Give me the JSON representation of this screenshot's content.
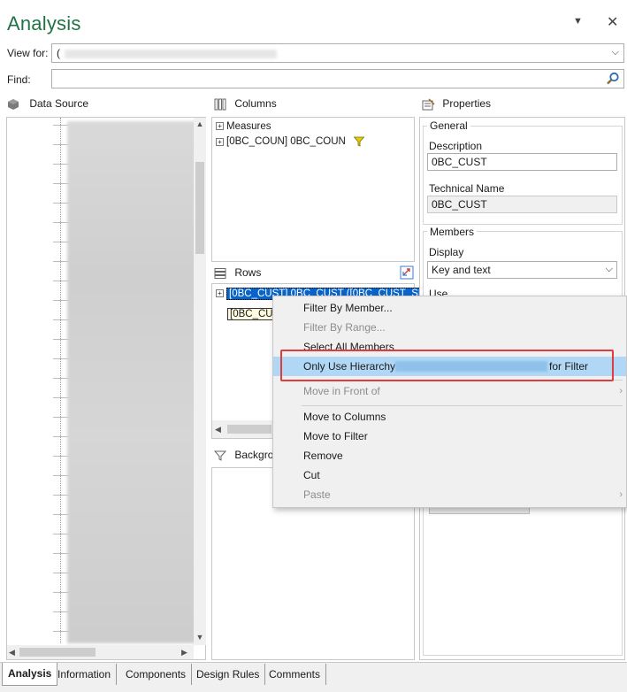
{
  "header": {
    "title": "Analysis",
    "dropdown_icon": "chevron-down-icon",
    "close_icon": "close-icon"
  },
  "view_for": {
    "label": "View for:",
    "value": "("
  },
  "find": {
    "label": "Find:",
    "value": ""
  },
  "data_source": {
    "title": "Data Source"
  },
  "columns": {
    "title": "Columns",
    "items": [
      {
        "label": "Measures"
      },
      {
        "label": "[0BC_COUN] 0BC_COUN"
      }
    ]
  },
  "rows": {
    "title": "Rows",
    "item1": "[0BC_CUST] 0BC_CUST ([0BC_CUST_SRAT...",
    "item2": "[0BC_CUS"
  },
  "background": {
    "title": "Backgro"
  },
  "properties": {
    "title": "Properties",
    "general": {
      "title": "General",
      "description_label": "Description",
      "description_value": "0BC_CUST",
      "technical_name_label": "Technical Name",
      "technical_name_value": "0BC_CUST"
    },
    "members": {
      "title": "Members",
      "display_label": "Display",
      "display_value": "Key and text",
      "use_label": "Use"
    }
  },
  "context_menu": {
    "items": [
      {
        "label": "Filter By Member...",
        "disabled": false
      },
      {
        "label": "Filter By Range...",
        "disabled": true
      },
      {
        "label": "Select All Members",
        "disabled": false
      },
      {
        "label": "Only Use Hierarchy",
        "suffix": "for Filter",
        "disabled": false,
        "highlighted": true
      },
      {
        "label": "Move in Front of",
        "disabled": true,
        "submenu": true
      },
      {
        "label": "Move to Columns",
        "disabled": false
      },
      {
        "label": "Move to Filter",
        "disabled": false
      },
      {
        "label": "Remove",
        "disabled": false
      },
      {
        "label": "Cut",
        "disabled": false
      },
      {
        "label": "Paste",
        "disabled": true,
        "submenu": true
      }
    ],
    "highlight_color": "#b0d7f6",
    "callout_color": "#e03c3c"
  },
  "tabs": [
    "Analysis",
    "Information",
    "Components",
    "Design Rules",
    "Comments"
  ],
  "colors": {
    "title": "#217346",
    "selection": "#0a64c8"
  }
}
